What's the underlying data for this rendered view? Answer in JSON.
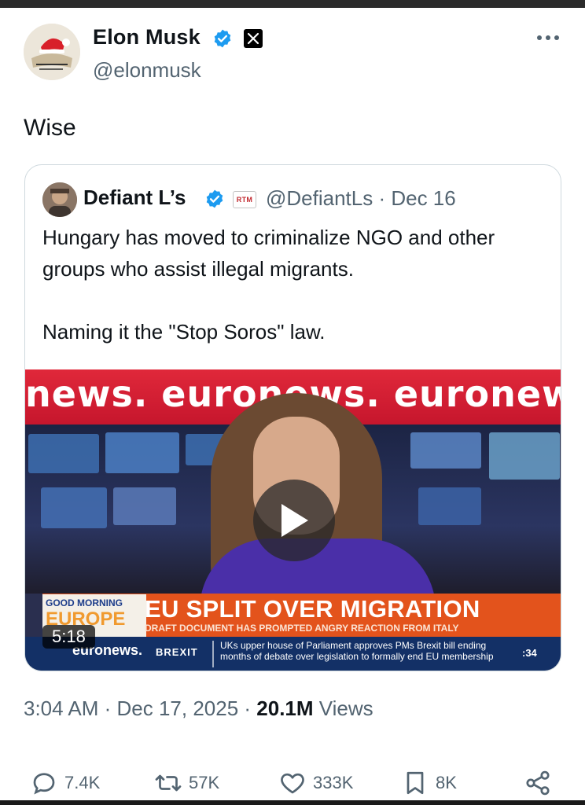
{
  "author": {
    "name": "Elon Musk",
    "handle": "@elonmusk",
    "verified_color": "#1d9bf0",
    "affiliate_badge_icon": "x-logo-icon",
    "more_icon": "more-horizontal-icon"
  },
  "tweet": {
    "text": "Wise",
    "timestamp": "3:04 AM · Dec 17, 2025 · ",
    "views_count": "20.1M",
    "views_label": " Views"
  },
  "quote": {
    "name": "Defiant L’s",
    "badge": "RTM",
    "handle_date": "@DefiantLs · Dec 16",
    "paragraphs": [
      "Hungary has moved to criminalize NGO and other groups who assist illegal migrants.",
      "Naming it the \"Stop Soros\" law."
    ],
    "video": {
      "banner_text": "news. euronews. euronews.",
      "brand_small": "GOOD MORNING",
      "brand_large": "EUROPE",
      "headline": "EU SPLIT OVER MIGRATION",
      "subhead": "DRAFT DOCUMENT HAS PROMPTED ANGRY REACTION FROM ITALY",
      "ticker_brand": "euronews.",
      "ticker_tag": "BREXIT",
      "ticker_text": "UKs upper house of Parliament approves PMs Brexit bill ending months of debate over legislation to formally end EU membership",
      "ticker_time": ":34",
      "duration": "5:18",
      "play_icon": "play-icon"
    }
  },
  "actions": {
    "replies": "7.4K",
    "reposts": "57K",
    "likes": "333K",
    "bookmarks": "8K"
  }
}
